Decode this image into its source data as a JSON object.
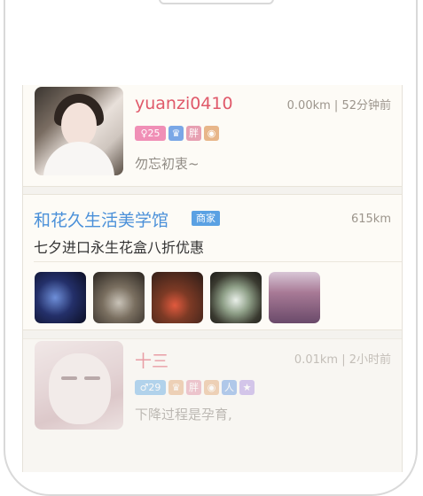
{
  "users": [
    {
      "username": "yuanzi0410",
      "distance": "0.00km",
      "time_ago": "52分钟前",
      "age_badge": "♀25",
      "badges": [
        "♛",
        "胖",
        "◉"
      ],
      "signature": "勿忘初衷~"
    },
    {
      "username": "十三",
      "distance": "0.01km",
      "time_ago": "2小时前",
      "age_badge": "♂29",
      "badges": [
        "♛",
        "胖",
        "◉",
        "人",
        "★"
      ],
      "signature": "下降过程是孕育,"
    }
  ],
  "shop": {
    "name": "和花久生活美学馆",
    "tag": "商家",
    "distance": "615km",
    "promo": "七夕进口永生花盒八折优惠",
    "photo_count": 5
  },
  "separator": " | ",
  "colors": {
    "username": "#e0596a",
    "shop_name": "#4a90d9",
    "shop_tag": "#5aa1e3",
    "meta": "#9c958c"
  }
}
